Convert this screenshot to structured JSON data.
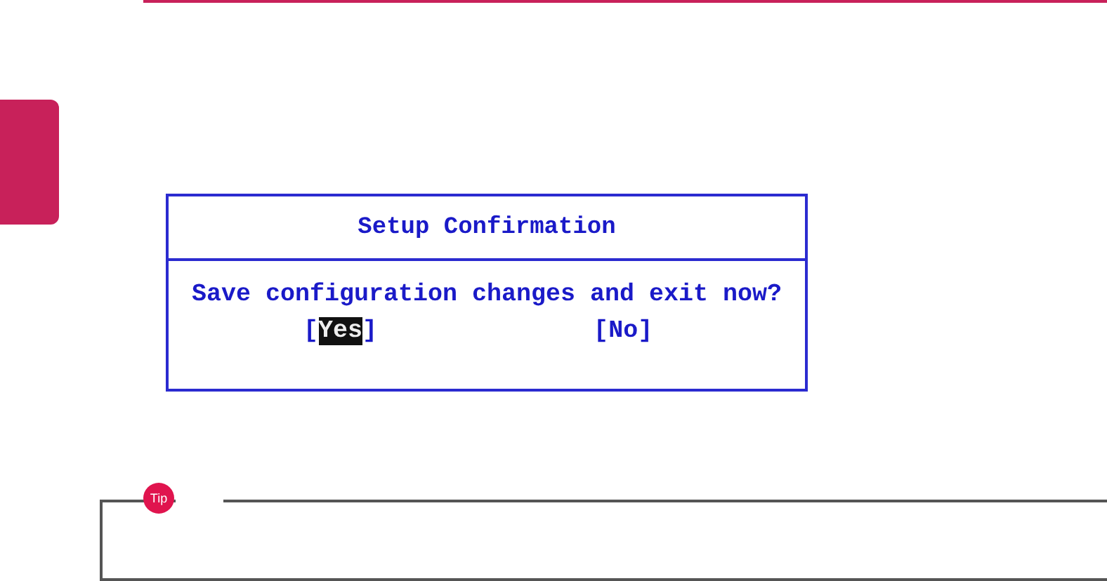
{
  "dialog": {
    "title": "Setup Confirmation",
    "message": "Save configuration changes and exit now?",
    "options": [
      {
        "open": "[",
        "label": "Yes",
        "close": "]",
        "selected": true
      },
      {
        "open": "[",
        "label": "No",
        "close": "]",
        "selected": false
      }
    ]
  },
  "tip": {
    "badge": "Tip"
  }
}
